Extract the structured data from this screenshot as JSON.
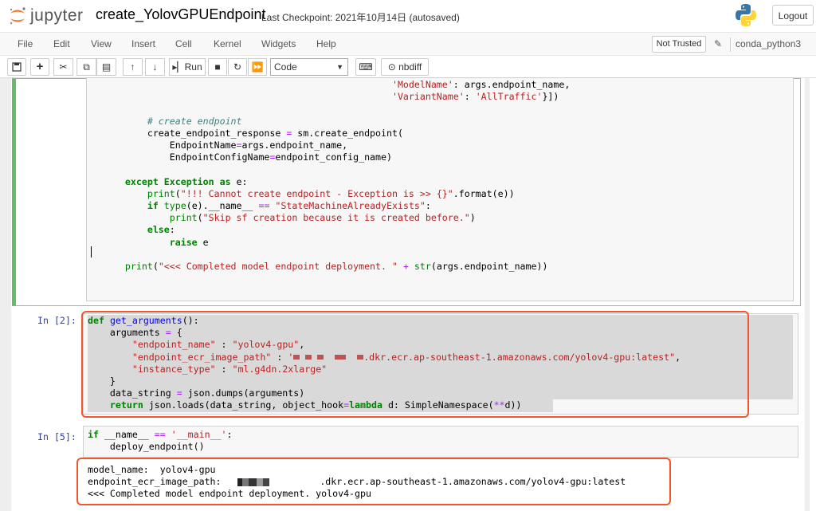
{
  "header": {
    "logo_text": "jupyter",
    "notebook_name": "create_YolovGPUEndpoint",
    "checkpoint": "Last Checkpoint: 2021年10月14日   (autosaved)",
    "logout_label": "Logout"
  },
  "menu": {
    "items": [
      "File",
      "Edit",
      "View",
      "Insert",
      "Cell",
      "Kernel",
      "Widgets",
      "Help"
    ],
    "not_trusted": "Not Trusted",
    "kernel": "conda_python3"
  },
  "toolbar": {
    "run_label": "Run",
    "cell_type": "Code",
    "nbdiff_label": "nbdiff"
  },
  "cells": {
    "cell2_prompt": "In [2]:",
    "cell3_prompt": "In [5]:"
  },
  "output": {
    "line1": "model_name:  yolov4-gpu",
    "line2_prefix": "endpoint_ecr_image_path: ",
    "line2_suffix": ".dkr.ecr.ap-southeast-1.amazonaws.com/yolov4-gpu:latest",
    "line3": "<<< Completed model endpoint deployment. yolov4-gpu"
  },
  "colors": {
    "accent_green": "#66bb6a",
    "highlight_orange": "#f0582c",
    "prompt_blue": "#303f9f"
  }
}
